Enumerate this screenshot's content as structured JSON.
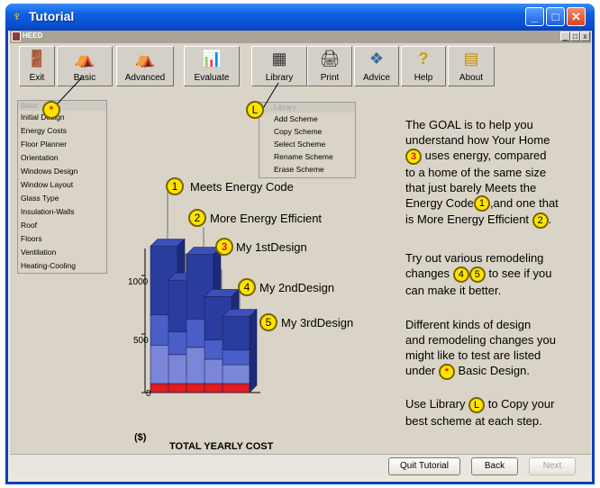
{
  "window": {
    "title": "Tutorial",
    "inner_title": "HEED"
  },
  "toolbar": [
    {
      "label": "Exit",
      "icon": "exit-icon",
      "glyph": "🚪"
    },
    {
      "label": "Basic",
      "icon": "basic-icon",
      "glyph": "⛺"
    },
    {
      "label": "Advanced",
      "icon": "advanced-icon",
      "glyph": "⛺"
    },
    {
      "label": "Evaluate",
      "icon": "evaluate-icon",
      "glyph": "📊"
    },
    {
      "label": "Library",
      "icon": "library-icon",
      "glyph": "▦"
    },
    {
      "label": "Print",
      "icon": "print-icon",
      "glyph": "🖨"
    },
    {
      "label": "Advice",
      "icon": "advice-icon",
      "glyph": "❖"
    },
    {
      "label": "Help",
      "icon": "help-icon",
      "glyph": "?"
    },
    {
      "label": "About",
      "icon": "about-icon",
      "glyph": "▤"
    }
  ],
  "basic_menu": {
    "header": "Basic",
    "items": [
      "Initial Design",
      "Energy Costs",
      "Floor Planner",
      "Orientation",
      "Windows Design",
      "Window Layout",
      "Glass Type",
      "Insulation-Walls",
      "Roof",
      "Floors",
      "Ventilation",
      "Heating-Cooling"
    ]
  },
  "library_menu": {
    "header": "Library",
    "items": [
      "Add Scheme",
      "Copy Scheme",
      "Select Scheme",
      "Rename Scheme",
      "Erase Scheme"
    ]
  },
  "badges": {
    "star": "*",
    "library": "L",
    "one": "1",
    "two": "2",
    "three": "3",
    "four": "4",
    "five": "5"
  },
  "chart_data": {
    "type": "bar",
    "xlabel": "TOTAL YEARLY COST",
    "ylabel": "($)",
    "yticks": [
      0,
      500,
      1000
    ],
    "categories": [
      "Meets Energy Code",
      "More Energy Efficient",
      "My 1stDesign",
      "My 2ndDesign",
      "My 3rdDesign"
    ],
    "values": [
      1250,
      960,
      1180,
      820,
      650
    ],
    "colors": {
      "dark": "#2a3d9e",
      "mid": "#4a5ec8",
      "light": "#7b86d6",
      "base": "#e01c1c"
    }
  },
  "explanation": {
    "p1a": "The GOAL is to help you",
    "p1b": "understand how Your Home",
    "p1c": "uses energy, compared",
    "p1d": "to a home of the same size",
    "p1e": "that just barely Meets the",
    "p1f": "Energy Code",
    "p1g": ",and one that",
    "p1h": "is More Energy Efficient",
    "p2a": "Try out various remodeling",
    "p2b": "changes",
    "p2c": "to see if you",
    "p2d": "can make it better.",
    "p3a": "Different kinds of design",
    "p3b": "and remodeling changes you",
    "p3c": "might like to test are listed",
    "p3d": "under",
    "p3e": "Basic Design.",
    "p4a": "Use Library",
    "p4b": "to Copy your",
    "p4c": "best scheme at each step."
  },
  "buttons": {
    "quit": "Quit Tutorial",
    "back": "Back",
    "next": "Next"
  }
}
